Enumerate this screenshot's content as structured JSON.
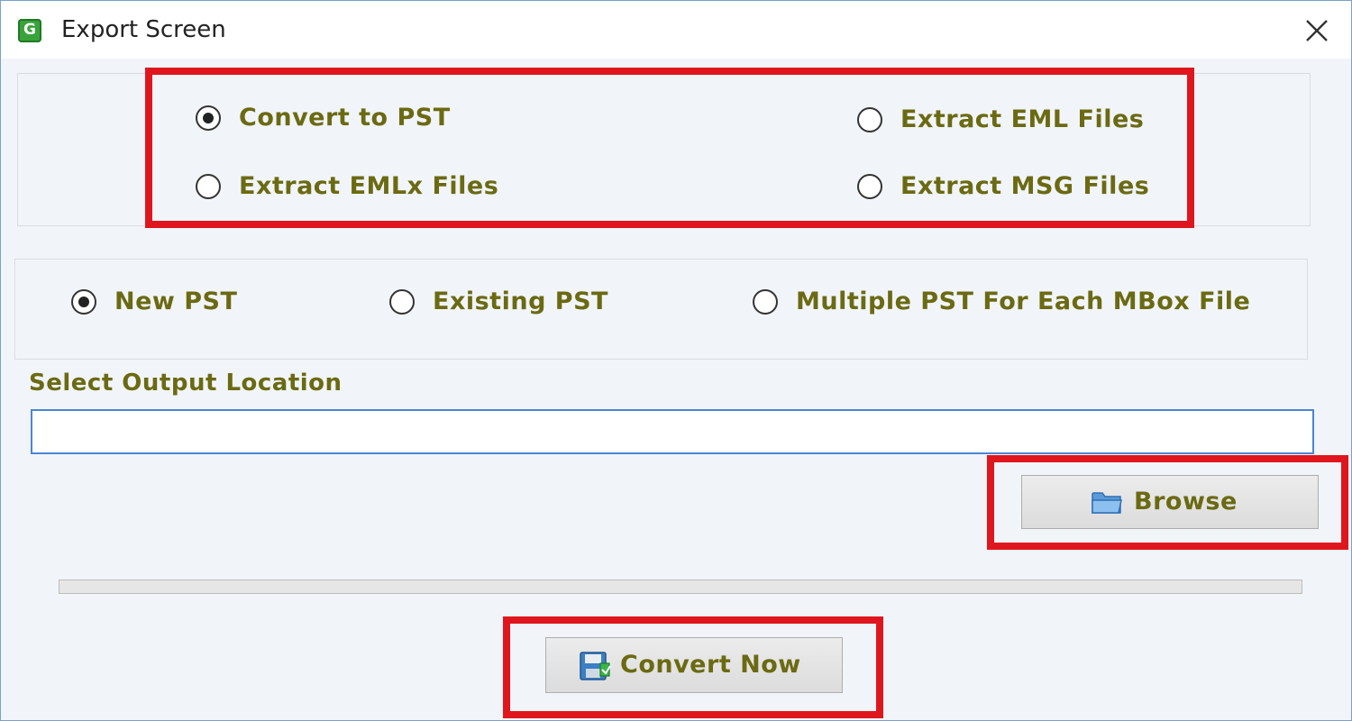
{
  "window": {
    "title": "Export Screen",
    "app_icon_letter": "G",
    "close_icon": "close-icon"
  },
  "export_options": {
    "items": [
      {
        "label": "Convert to PST",
        "selected": true
      },
      {
        "label": "Extract EML Files",
        "selected": false
      },
      {
        "label": "Extract EMLx Files",
        "selected": false
      },
      {
        "label": "Extract MSG Files",
        "selected": false
      }
    ]
  },
  "pst_options": {
    "items": [
      {
        "label": "New PST",
        "selected": true
      },
      {
        "label": "Existing PST",
        "selected": false
      },
      {
        "label": "Multiple PST For Each MBox File",
        "selected": false
      }
    ]
  },
  "output": {
    "label": "Select Output Location",
    "value": ""
  },
  "buttons": {
    "browse_label": "Browse",
    "browse_icon": "folder-icon",
    "convert_label": "Convert Now",
    "convert_icon": "save-icon"
  },
  "progress": {
    "value": 0
  },
  "colors": {
    "label_text": "#6b6a12",
    "highlight": "#e0161e",
    "input_border": "#4a86d4"
  }
}
